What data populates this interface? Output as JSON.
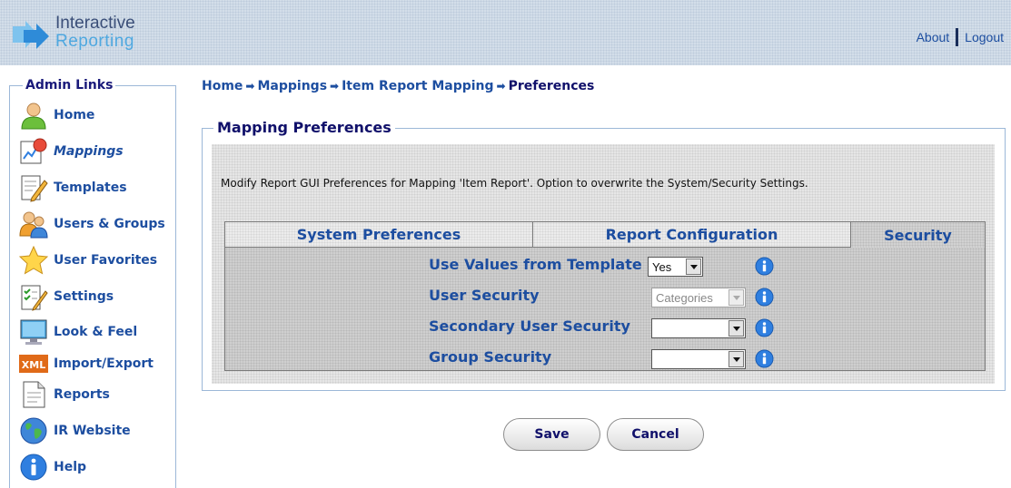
{
  "header": {
    "logo_line1": "Interactive",
    "logo_line2": "Reporting",
    "about_label": "About",
    "logout_label": "Logout"
  },
  "sidebar": {
    "legend": "Admin Links",
    "items": [
      {
        "label": "Home",
        "icon": "user-icon"
      },
      {
        "label": "Mappings",
        "icon": "mappings-icon"
      },
      {
        "label": "Templates",
        "icon": "templates-icon"
      },
      {
        "label": "Users & Groups",
        "icon": "users-groups-icon"
      },
      {
        "label": "User Favorites",
        "icon": "star-icon"
      },
      {
        "label": "Settings",
        "icon": "settings-icon"
      },
      {
        "label": "Look & Feel",
        "icon": "monitor-icon"
      },
      {
        "label": "Import/Export",
        "icon": "xml-icon"
      },
      {
        "label": "Reports",
        "icon": "document-icon"
      },
      {
        "label": "IR Website",
        "icon": "globe-icon"
      },
      {
        "label": "Help",
        "icon": "info-icon"
      }
    ],
    "active_item": "Mappings"
  },
  "breadcrumb": {
    "items": [
      "Home",
      "Mappings",
      "Item Report Mapping"
    ],
    "current": "Preferences",
    "separator": "➡"
  },
  "panel": {
    "legend": "Mapping Preferences",
    "description": "Modify Report GUI Preferences for Mapping 'Item Report'. Option to overwrite the System/Security Settings."
  },
  "tabs": [
    {
      "label": "System Preferences",
      "selected": false
    },
    {
      "label": "Report Configuration",
      "selected": false
    },
    {
      "label": "Security",
      "selected": true
    }
  ],
  "security_form": {
    "use_values_from_template": {
      "label": "Use Values from Template",
      "value": "Yes"
    },
    "user_security": {
      "label": "User Security",
      "value": "Categories",
      "disabled": true
    },
    "secondary_user_security": {
      "label": "Secondary User Security",
      "value": ""
    },
    "group_security": {
      "label": "Group Security",
      "value": ""
    }
  },
  "buttons": {
    "save_label": "Save",
    "cancel_label": "Cancel"
  },
  "colors": {
    "link_blue": "#1d4ea0",
    "heading_navy": "#10106a",
    "border_light_blue": "#9cb8d8",
    "info_blue": "#2f7fe0"
  }
}
